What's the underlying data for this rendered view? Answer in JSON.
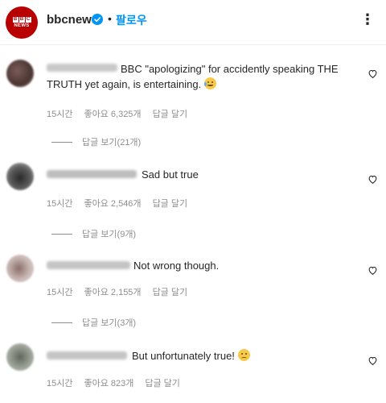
{
  "header": {
    "avatar_blocks": [
      "B",
      "B",
      "C"
    ],
    "avatar_news": "NEWS",
    "username": "bbcnews",
    "separator": "•",
    "follow_label": "팔로우",
    "more_label": "⋮"
  },
  "comments": [
    {
      "text": "BBC \"apologizing\" for accidently speaking THE TRUTH yet again, is entertaining.",
      "emoji": "laughing-crying",
      "time": "15시간",
      "likes": "좋아요 6,325개",
      "reply": "답글 달기",
      "view_replies": "답글 보기(21개)"
    },
    {
      "text": "Sad but true",
      "time": "15시간",
      "likes": "좋아요 2,546개",
      "reply": "답글 달기",
      "view_replies": "답글 보기(9개)"
    },
    {
      "text": "Not wrong though.",
      "time": "15시간",
      "likes": "좋아요 2,155개",
      "reply": "답글 달기",
      "view_replies": "답글 보기(3개)"
    },
    {
      "text": "But unfortunately true!",
      "emoji": "sad",
      "time": "15시간",
      "likes": "좋아요 823개",
      "reply": "답글 달기"
    }
  ],
  "colors": {
    "brand": "#b80000",
    "follow": "#0095f6",
    "verified": "#0095f6",
    "meta": "#8e8e8e"
  }
}
